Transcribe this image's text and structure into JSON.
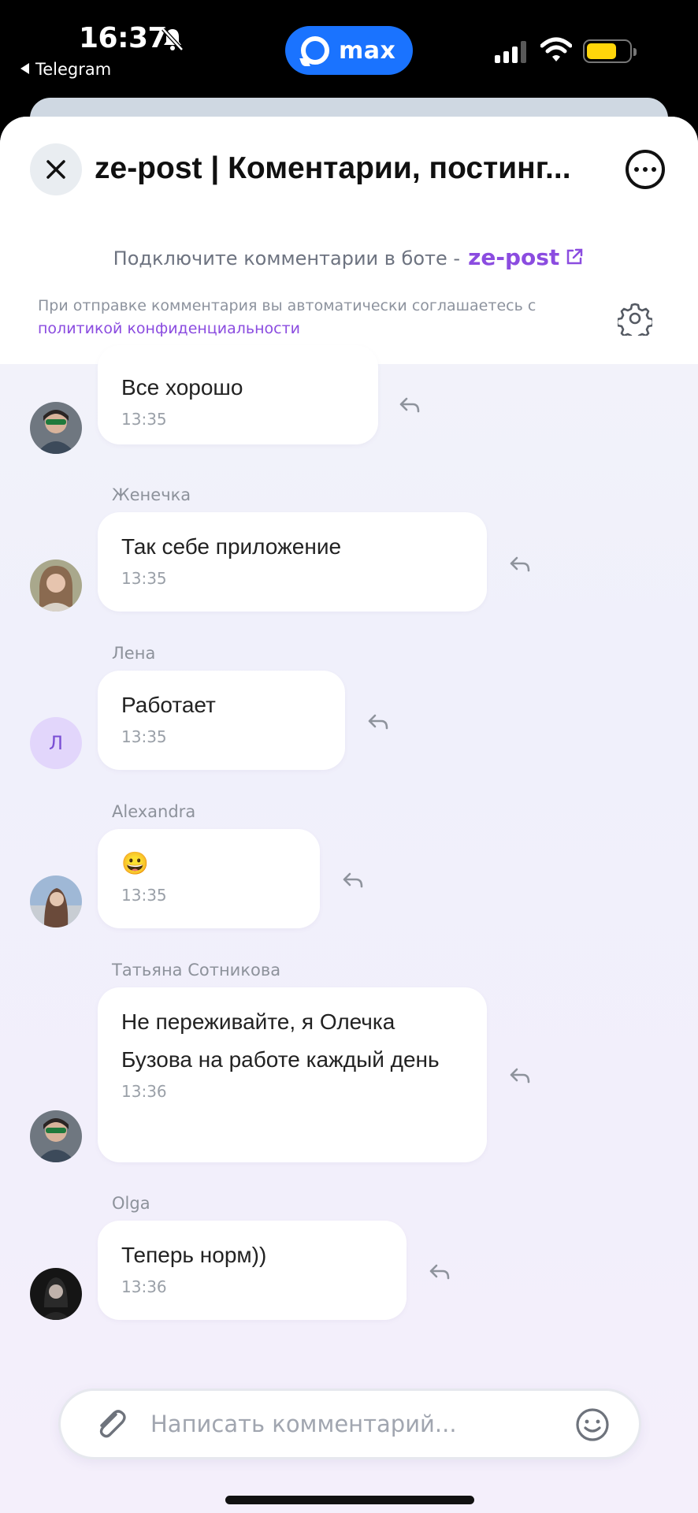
{
  "status_bar": {
    "time": "16:37",
    "back_app": "Telegram",
    "center_app": "max",
    "battery_color": "#ffd60a",
    "icons": [
      "bell-slash-icon",
      "signal-icon",
      "wifi-icon",
      "battery-icon"
    ]
  },
  "header": {
    "title": "ze-post | Коментарии, постинг...",
    "close_icon": "close-icon",
    "more_icon": "more-icon",
    "connect_text": "Подключите комментарии в боте -",
    "bot_link": "ze-post",
    "consent_text": "При отправке комментария вы автоматически соглашаетесь с",
    "consent_link": "политикой конфиденциальности"
  },
  "messages": [
    {
      "author": "",
      "text": "Все хорошо",
      "time": "13:35",
      "avatar": "photo"
    },
    {
      "author": "Женечка",
      "text": "Так себе приложение",
      "time": "13:35",
      "avatar": "photo"
    },
    {
      "author": "Лена",
      "text": "Работает",
      "time": "13:35",
      "avatar": "Л"
    },
    {
      "author": "Alexandra",
      "text": "😀",
      "time": "13:35",
      "avatar": "photo"
    },
    {
      "author": "Татьяна Сотникова",
      "text": "Не переживайте, я Олечка Бузова на работе каждый день",
      "time": "13:36",
      "avatar": "photo"
    },
    {
      "author": "Olga",
      "text": "Теперь норм))",
      "time": "13:36",
      "avatar": "photo"
    }
  ],
  "composer": {
    "placeholder": "Написать комментарий...",
    "attach_icon": "paperclip-icon",
    "emoji_icon": "smiley-icon"
  },
  "colors": {
    "accent": "#8b4ce0",
    "max_brand": "#1a73ff",
    "letter_avatar_bg": "#e2d6fb"
  }
}
